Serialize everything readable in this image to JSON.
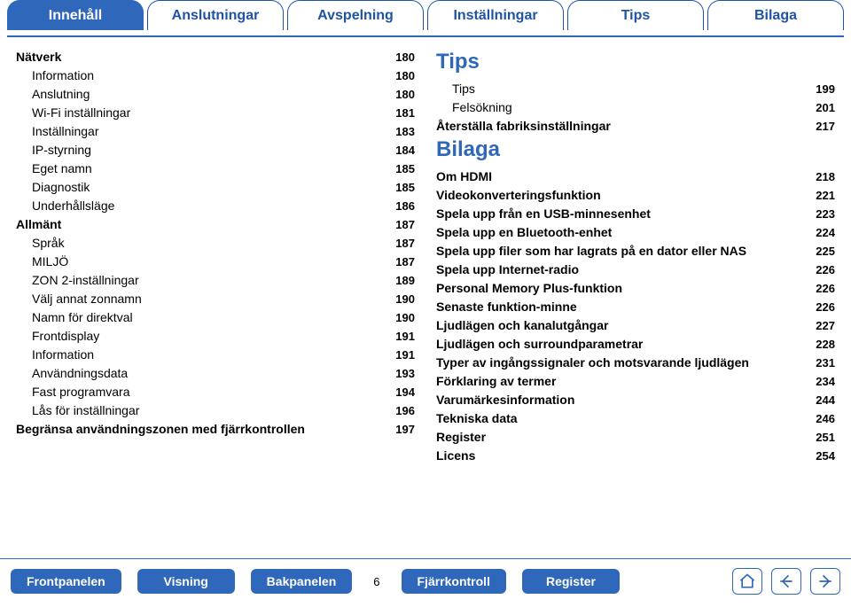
{
  "tabs": [
    {
      "label": "Innehåll",
      "active": true
    },
    {
      "label": "Anslutningar",
      "active": false
    },
    {
      "label": "Avspelning",
      "active": false
    },
    {
      "label": "Inställningar",
      "active": false
    },
    {
      "label": "Tips",
      "active": false
    },
    {
      "label": "Bilaga",
      "active": false
    }
  ],
  "left_column": [
    {
      "label": "Nätverk",
      "page": "180",
      "indent": 0
    },
    {
      "label": "Information",
      "page": "180",
      "indent": 1
    },
    {
      "label": "Anslutning",
      "page": "180",
      "indent": 1
    },
    {
      "label": "Wi-Fi inställningar",
      "page": "181",
      "indent": 1
    },
    {
      "label": "Inställningar",
      "page": "183",
      "indent": 1
    },
    {
      "label": "IP-styrning",
      "page": "184",
      "indent": 1
    },
    {
      "label": "Eget namn",
      "page": "185",
      "indent": 1
    },
    {
      "label": "Diagnostik",
      "page": "185",
      "indent": 1
    },
    {
      "label": "Underhållsläge",
      "page": "186",
      "indent": 1
    },
    {
      "label": "Allmänt",
      "page": "187",
      "indent": 0
    },
    {
      "label": "Språk",
      "page": "187",
      "indent": 1
    },
    {
      "label": "MILJÖ",
      "page": "187",
      "indent": 1
    },
    {
      "label": "ZON 2-inställningar",
      "page": "189",
      "indent": 1
    },
    {
      "label": "Välj annat zonnamn",
      "page": "190",
      "indent": 1
    },
    {
      "label": "Namn för direktval",
      "page": "190",
      "indent": 1
    },
    {
      "label": "Frontdisplay",
      "page": "191",
      "indent": 1
    },
    {
      "label": "Information",
      "page": "191",
      "indent": 1
    },
    {
      "label": "Användningsdata",
      "page": "193",
      "indent": 1
    },
    {
      "label": "Fast programvara",
      "page": "194",
      "indent": 1
    },
    {
      "label": "Lås för inställningar",
      "page": "196",
      "indent": 1
    },
    {
      "label": "Begränsa användningszonen med fjärrkontrollen",
      "page": "197",
      "indent": 0
    }
  ],
  "right_sections": [
    {
      "title": "Tips",
      "items": [
        {
          "label": "Tips",
          "page": "199",
          "indent": 1
        },
        {
          "label": "Felsökning",
          "page": "201",
          "indent": 1
        },
        {
          "label": "Återställa fabriksinställningar",
          "page": "217",
          "indent": 0
        }
      ]
    },
    {
      "title": "Bilaga",
      "items": [
        {
          "label": "Om HDMI",
          "page": "218",
          "indent": 0
        },
        {
          "label": "Videokonverteringsfunktion",
          "page": "221",
          "indent": 0
        },
        {
          "label": "Spela upp från en USB-minnesenhet",
          "page": "223",
          "indent": 0
        },
        {
          "label": "Spela upp en Bluetooth-enhet",
          "page": "224",
          "indent": 0
        },
        {
          "label": "Spela upp filer som har lagrats på en dator eller NAS",
          "page": "225",
          "indent": 0
        },
        {
          "label": "Spela upp Internet-radio",
          "page": "226",
          "indent": 0
        },
        {
          "label": "Personal Memory Plus-funktion",
          "page": "226",
          "indent": 0
        },
        {
          "label": "Senaste funktion-minne",
          "page": "226",
          "indent": 0
        },
        {
          "label": "Ljudlägen och kanalutgångar",
          "page": "227",
          "indent": 0
        },
        {
          "label": "Ljudlägen och surroundparametrar",
          "page": "228",
          "indent": 0
        },
        {
          "label": "Typer av ingångssignaler och motsvarande ljudlägen",
          "page": "231",
          "indent": 0
        },
        {
          "label": "Förklaring av termer",
          "page": "234",
          "indent": 0
        },
        {
          "label": "Varumärkesinformation",
          "page": "244",
          "indent": 0
        },
        {
          "label": "Tekniska data",
          "page": "246",
          "indent": 0
        },
        {
          "label": "Register",
          "page": "251",
          "indent": 0
        },
        {
          "label": "Licens",
          "page": "254",
          "indent": 0
        }
      ]
    }
  ],
  "bottom_buttons": [
    "Frontpanelen",
    "Visning",
    "Bakpanelen"
  ],
  "page_number": "6",
  "bottom_buttons_2": [
    "Fjärrkontroll",
    "Register"
  ],
  "nav_icons": [
    "home-icon",
    "prev-icon",
    "next-icon"
  ]
}
